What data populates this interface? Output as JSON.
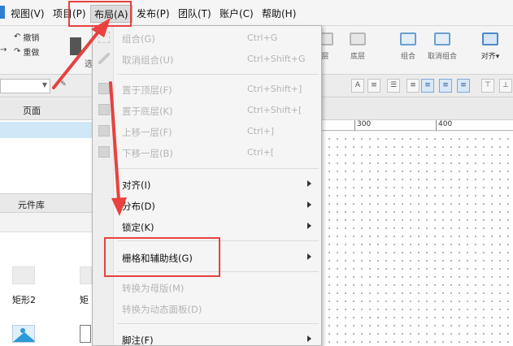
{
  "menubar": {
    "items": [
      "视图(V)",
      "项目(P)",
      "布局(A)",
      "发布(P)",
      "团队(T)",
      "账户(C)",
      "帮助(H)"
    ]
  },
  "toolbar": {
    "undo": "撤销",
    "redo": "重做",
    "top_layer": "层",
    "bottom_layer": "底层",
    "group": "组合",
    "ungroup": "取消组合",
    "align": "对齐▾",
    "partial_label": "选"
  },
  "left_panel": {
    "pages_title": "页面",
    "widgets_title": "元件库",
    "widgets": [
      "矩形2",
      "矩"
    ]
  },
  "ruler": {
    "labels": [
      "300",
      "400"
    ]
  },
  "dropdown": {
    "items": [
      {
        "label": "组合(G)",
        "shortcut": "Ctrl+G"
      },
      {
        "label": "取消组合(U)",
        "shortcut": "Ctrl+Shift+G"
      },
      {
        "label": "置于顶层(F)",
        "shortcut": "Ctrl+Shift+]"
      },
      {
        "label": "置于底层(K)",
        "shortcut": "Ctrl+Shift+["
      },
      {
        "label": "上移一层(F)",
        "shortcut": "Ctrl+]"
      },
      {
        "label": "下移一层(B)",
        "shortcut": "Ctrl+["
      },
      {
        "label": "对齐(I)"
      },
      {
        "label": "分布(D)"
      },
      {
        "label": "锁定(K)"
      },
      {
        "label": "栅格和辅助线(G)"
      },
      {
        "label": "转换为母版(M)"
      },
      {
        "label": "转换为动态面板(D)"
      },
      {
        "label": "脚注(F)"
      }
    ]
  },
  "colors": {
    "annotation": "#e8413f",
    "selected_row": "#cfe7f7",
    "accent": "#2a9ad8"
  }
}
